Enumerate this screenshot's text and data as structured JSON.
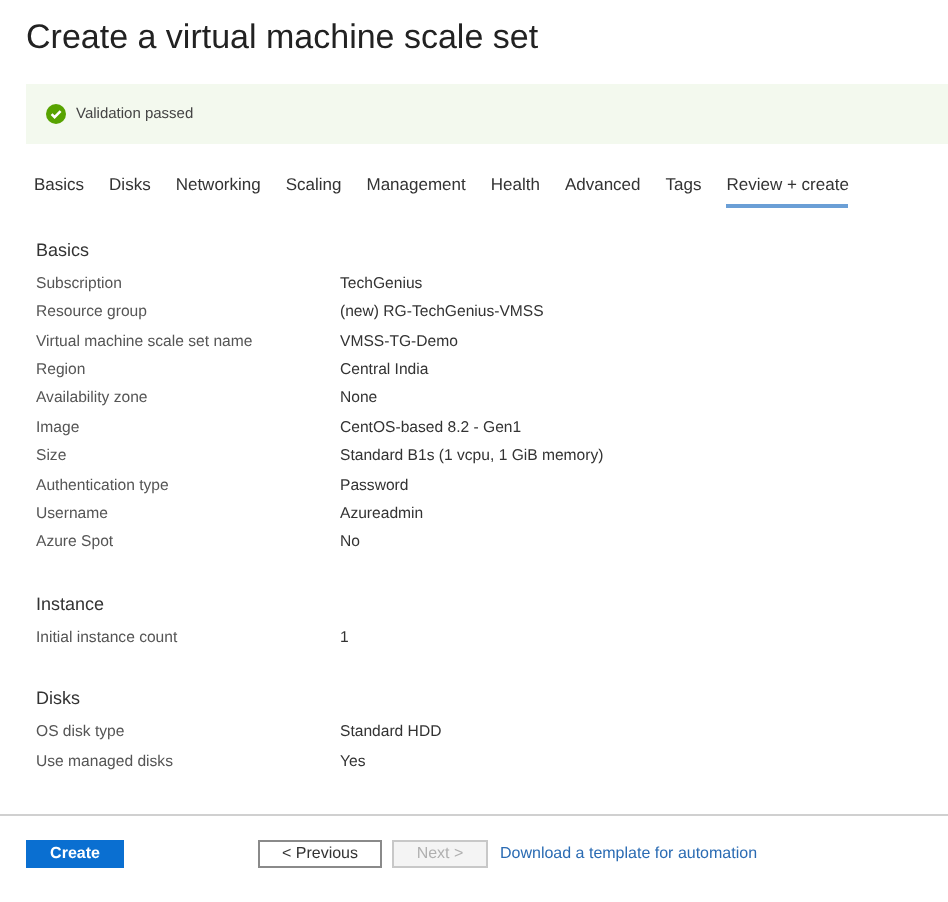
{
  "title": "Create a virtual machine scale set",
  "validation": {
    "message": "Validation passed",
    "passed": true
  },
  "tabs": [
    {
      "label": "Basics",
      "selected": false
    },
    {
      "label": "Disks",
      "selected": false
    },
    {
      "label": "Networking",
      "selected": false
    },
    {
      "label": "Scaling",
      "selected": false
    },
    {
      "label": "Management",
      "selected": false
    },
    {
      "label": "Health",
      "selected": false
    },
    {
      "label": "Advanced",
      "selected": false
    },
    {
      "label": "Tags",
      "selected": false
    },
    {
      "label": "Review + create",
      "selected": true
    }
  ],
  "sections": [
    {
      "heading": "Basics",
      "rows": [
        {
          "label": "Subscription",
          "value": "TechGenius"
        },
        {
          "label": "Resource group",
          "value": "(new) RG-TechGenius-VMSS"
        },
        {
          "label": "Virtual machine scale set name",
          "value": "VMSS-TG-Demo"
        },
        {
          "label": "Region",
          "value": "Central India"
        },
        {
          "label": "Availability zone",
          "value": "None"
        },
        {
          "label": "Image",
          "value": "CentOS-based 8.2 - Gen1"
        },
        {
          "label": "Size",
          "value": "Standard B1s (1 vcpu, 1 GiB memory)"
        },
        {
          "label": "Authentication type",
          "value": "Password"
        },
        {
          "label": "Username",
          "value": "Azureadmin"
        },
        {
          "label": "Azure Spot",
          "value": "No"
        }
      ]
    },
    {
      "heading": "Instance",
      "rows": [
        {
          "label": "Initial instance count",
          "value": "1"
        }
      ]
    },
    {
      "heading": "Disks",
      "rows": [
        {
          "label": "OS disk type",
          "value": "Standard HDD"
        },
        {
          "label": "Use managed disks",
          "value": "Yes"
        }
      ]
    }
  ],
  "footer": {
    "create": "Create",
    "previous": {
      "label": "< Previous",
      "disabled": false
    },
    "next": {
      "label": "Next >",
      "disabled": true
    },
    "link": "Download a template for automation"
  }
}
